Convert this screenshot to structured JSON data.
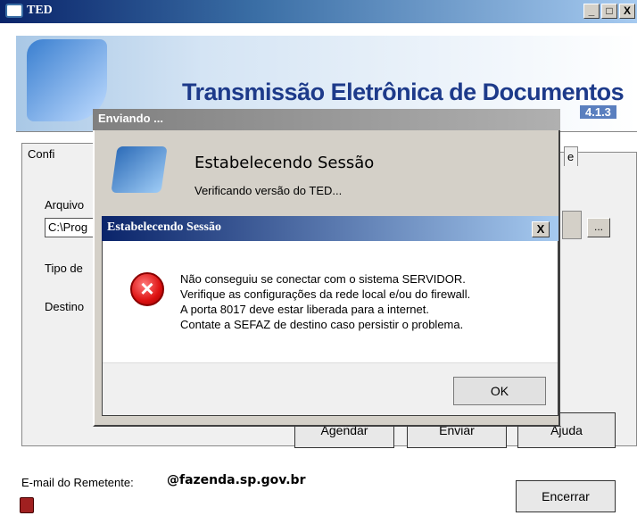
{
  "window": {
    "title": "TED",
    "min": "_",
    "max": "□",
    "close": "X"
  },
  "banner": {
    "title": "Transmissão Eletrônica de Documentos",
    "version": "4.1.3"
  },
  "main": {
    "tab_label": "Confi",
    "tab_right_label": "e",
    "arquivo_label": "Arquivo",
    "arquivo_value": "C:\\Prog",
    "tipo_label": "Tipo de",
    "destino_label": "Destino",
    "browse_label": "...",
    "buttons": {
      "agendar": "Agendar",
      "enviar": "Enviar",
      "ajuda": "Ajuda",
      "encerrar": "Encerrar"
    }
  },
  "footer": {
    "email_label": "E-mail do Remetente:",
    "email_value": "@fazenda.sp.gov.br"
  },
  "send_dialog": {
    "title": "Enviando ...",
    "heading": "Estabelecendo Sessão",
    "subtitle": "Verificando versão do TED..."
  },
  "error_dialog": {
    "title": "Estabelecendo Sessão",
    "close": "X",
    "message_lines": [
      "Não conseguiu se conectar com o sistema SERVIDOR.",
      "Verifique as configurações da rede local e/ou do firewall.",
      "A porta 8017 deve estar liberada para a internet.",
      "Contate a SEFAZ de destino caso persistir o problema."
    ],
    "ok_label": "OK"
  }
}
